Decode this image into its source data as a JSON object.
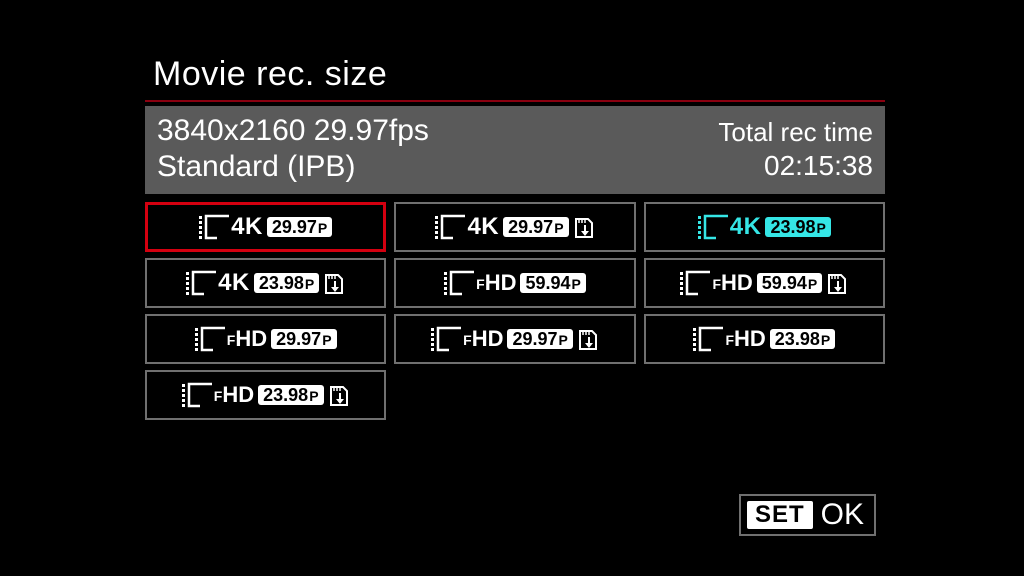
{
  "title": "Movie rec. size",
  "info": {
    "line1": "3840x2160 29.97fps",
    "line2": "Standard (IPB)",
    "rec_label": "Total rec time",
    "rec_time": "02:15:38"
  },
  "options": [
    {
      "res": "4K",
      "fps": "29.97",
      "card": false,
      "selected": true,
      "cyan": false
    },
    {
      "res": "4K",
      "fps": "29.97",
      "card": true,
      "selected": false,
      "cyan": false
    },
    {
      "res": "4K",
      "fps": "23.98",
      "card": false,
      "selected": false,
      "cyan": true
    },
    {
      "res": "4K",
      "fps": "23.98",
      "card": true,
      "selected": false,
      "cyan": false
    },
    {
      "res": "FHD",
      "fps": "59.94",
      "card": false,
      "selected": false,
      "cyan": false
    },
    {
      "res": "FHD",
      "fps": "59.94",
      "card": true,
      "selected": false,
      "cyan": false
    },
    {
      "res": "FHD",
      "fps": "29.97",
      "card": false,
      "selected": false,
      "cyan": false
    },
    {
      "res": "FHD",
      "fps": "29.97",
      "card": true,
      "selected": false,
      "cyan": false
    },
    {
      "res": "FHD",
      "fps": "23.98",
      "card": false,
      "selected": false,
      "cyan": false
    },
    {
      "res": "FHD",
      "fps": "23.98",
      "card": true,
      "selected": false,
      "cyan": false
    }
  ],
  "footer": {
    "set": "SET",
    "ok": "OK"
  }
}
